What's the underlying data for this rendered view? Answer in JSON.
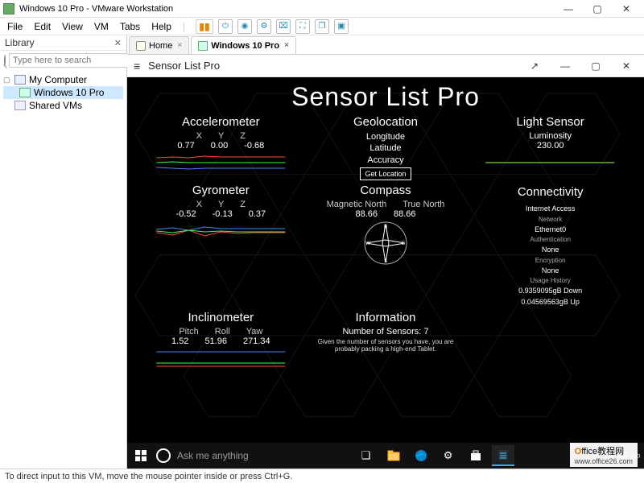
{
  "window": {
    "title": "Windows 10 Pro - VMware Workstation"
  },
  "menubar": {
    "file": "File",
    "edit": "Edit",
    "view": "View",
    "vm": "VM",
    "tabs": "Tabs",
    "help": "Help"
  },
  "sidebar": {
    "title": "Library",
    "search_placeholder": "Type here to search",
    "my_computer": "My Computer",
    "vm_name": "Windows 10 Pro",
    "shared_vms": "Shared VMs"
  },
  "tabs": {
    "home": "Home",
    "active": "Windows 10 Pro"
  },
  "inner": {
    "title": "Sensor List Pro"
  },
  "app": {
    "title": "Sensor List Pro",
    "accel": {
      "heading": "Accelerometer",
      "x_lbl": "X",
      "y_lbl": "Y",
      "z_lbl": "Z",
      "x": "0.77",
      "y": "0.00",
      "z": "-0.68"
    },
    "geo": {
      "heading": "Geolocation",
      "lon": "Longitude",
      "lat": "Latitude",
      "acc": "Accuracy",
      "btn": "Get Location"
    },
    "light": {
      "heading": "Light Sensor",
      "lbl": "Luminosity",
      "val": "230.00"
    },
    "gyro": {
      "heading": "Gyrometer",
      "x_lbl": "X",
      "y_lbl": "Y",
      "z_lbl": "Z",
      "x": "-0.52",
      "y": "-0.13",
      "z": "0.37"
    },
    "compass": {
      "heading": "Compass",
      "mag_lbl": "Magnetic North",
      "true_lbl": "True North",
      "mag": "88.66",
      "true": "88.66"
    },
    "conn": {
      "heading": "Connectivity",
      "ia": "Internet Access",
      "net_lbl": "Network",
      "net": "Ethernet0",
      "auth_lbl": "Authentication",
      "auth": "None",
      "enc_lbl": "Encryption",
      "enc": "None",
      "hist_lbl": "Usage History",
      "down": "0.9359095gB Down",
      "up": "0.04569563gB Up"
    },
    "incl": {
      "heading": "Inclinometer",
      "p_lbl": "Pitch",
      "r_lbl": "Roll",
      "y_lbl": "Yaw",
      "p": "1.52",
      "r": "51.96",
      "y": "271.34"
    },
    "info": {
      "heading": "Information",
      "count": "Number of Sensors: 7",
      "note": "Given the number of sensors you have, you are probably packing a high-end Tablet."
    }
  },
  "taskbar": {
    "search": "Ask me anything"
  },
  "statusbar": {
    "text": "To direct input to this VM, move the mouse pointer inside or press Ctrl+G."
  },
  "watermark": {
    "brand_o": "O",
    "brand_rest": "ffice教程网",
    "url": "www.office26.com"
  },
  "chart_data": [
    {
      "type": "line",
      "title": "Accelerometer",
      "series": [
        {
          "name": "X",
          "values": [
            0.7,
            0.75,
            0.72,
            0.78,
            0.74,
            0.77,
            0.76,
            0.77
          ]
        },
        {
          "name": "Y",
          "values": [
            0.0,
            0.02,
            -0.01,
            0.0,
            0.01,
            0.0,
            -0.01,
            0.0
          ]
        },
        {
          "name": "Z",
          "values": [
            -0.6,
            -0.65,
            -0.7,
            -0.66,
            -0.68,
            -0.67,
            -0.69,
            -0.68
          ]
        }
      ],
      "ylim": [
        -1,
        1
      ]
    },
    {
      "type": "line",
      "title": "Gyrometer",
      "series": [
        {
          "name": "X",
          "values": [
            -0.4,
            -0.6,
            -0.3,
            -0.7,
            -0.45,
            -0.55,
            -0.5,
            -0.52
          ]
        },
        {
          "name": "Y",
          "values": [
            -0.1,
            -0.2,
            0.05,
            -0.15,
            -0.1,
            -0.12,
            -0.14,
            -0.13
          ]
        },
        {
          "name": "Z",
          "values": [
            0.3,
            0.45,
            0.2,
            0.5,
            0.35,
            0.4,
            0.38,
            0.37
          ]
        }
      ],
      "ylim": [
        -1,
        1
      ]
    },
    {
      "type": "line",
      "title": "Light Sensor",
      "series": [
        {
          "name": "Luminosity",
          "values": [
            230,
            230,
            230,
            230,
            230,
            230,
            230,
            230
          ]
        }
      ],
      "ylim": [
        0,
        500
      ]
    },
    {
      "type": "line",
      "title": "Inclinometer",
      "series": [
        {
          "name": "Pitch",
          "values": [
            1.4,
            1.6,
            1.5,
            1.55,
            1.5,
            1.52,
            1.5,
            1.52
          ]
        },
        {
          "name": "Roll",
          "values": [
            50,
            52,
            51,
            53,
            51.5,
            52,
            51.8,
            51.96
          ]
        },
        {
          "name": "Yaw",
          "values": [
            270,
            272,
            271,
            273,
            271,
            271.5,
            271.2,
            271.34
          ]
        }
      ],
      "ylim": [
        0,
        360
      ]
    }
  ]
}
